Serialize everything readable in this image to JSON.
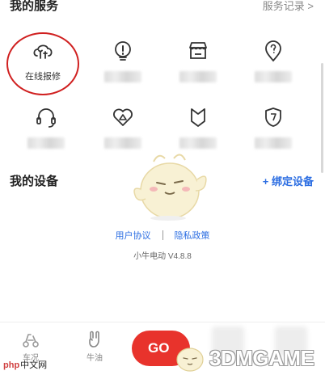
{
  "services": {
    "title": "我的服务",
    "records_link": "服务记录 >",
    "items": [
      {
        "label": "在线报修",
        "icon": "cloud-repair-icon",
        "highlighted": true
      },
      {
        "label": "",
        "icon": "lightbulb-icon"
      },
      {
        "label": "",
        "icon": "store-icon"
      },
      {
        "label": "",
        "icon": "location-question-icon"
      },
      {
        "label": "",
        "icon": "headset-icon"
      },
      {
        "label": "",
        "icon": "heart-triangle-icon"
      },
      {
        "label": "",
        "icon": "badge-icon"
      },
      {
        "label": "",
        "icon": "shield-icon"
      }
    ]
  },
  "devices": {
    "title": "我的设备",
    "bind_link": "+ 绑定设备"
  },
  "footer": {
    "user_agreement": "用户协议",
    "privacy_policy": "隐私政策",
    "version": "小牛电动 V4.8.8"
  },
  "bottom_nav": {
    "tab_vehicle": "车况",
    "tab_oil": "牛油",
    "go_label": "GO"
  },
  "watermarks": {
    "php_prefix": "php",
    "php_site": "中文网",
    "game_site": "3DMGAME"
  },
  "colors": {
    "accent_blue": "#2b6de2",
    "highlight_red": "#d02020",
    "go_red": "#e8332c"
  }
}
